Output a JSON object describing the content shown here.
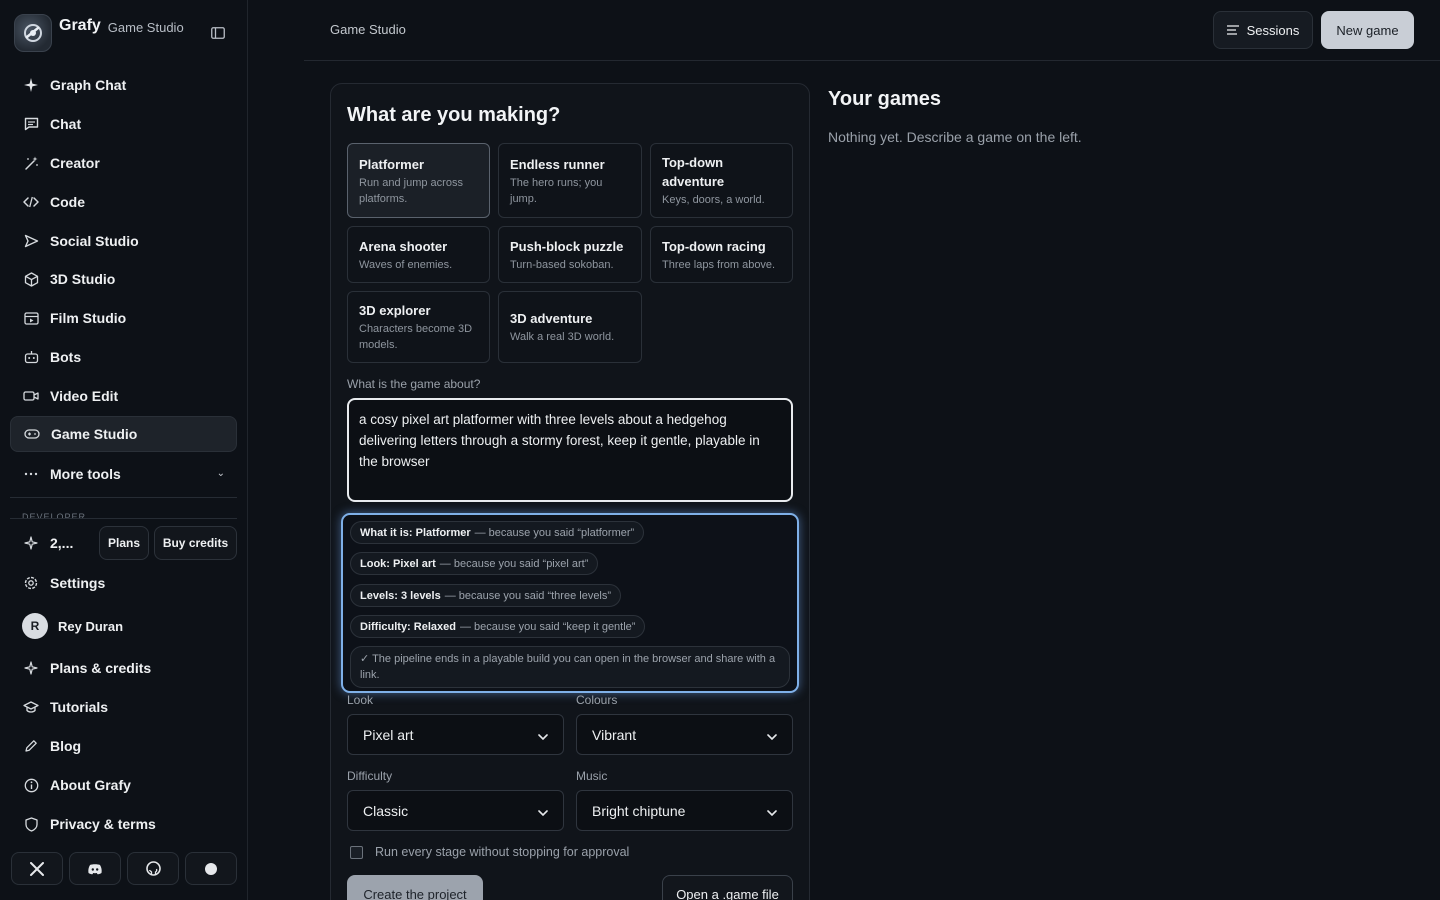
{
  "brand": {
    "name": "Grafy",
    "subtitle": "Game Studio"
  },
  "sidebar": {
    "items": [
      {
        "label": "Graph Chat",
        "icon": "sparkle-icon"
      },
      {
        "label": "Chat",
        "icon": "message-icon"
      },
      {
        "label": "Creator",
        "icon": "magic-wand-icon"
      },
      {
        "label": "Code",
        "icon": "code-icon"
      },
      {
        "label": "Social Studio",
        "icon": "send-icon"
      },
      {
        "label": "3D Studio",
        "icon": "cube-icon"
      },
      {
        "label": "Film Studio",
        "icon": "film-icon"
      },
      {
        "label": "Bots",
        "icon": "bot-icon"
      },
      {
        "label": "Video Edit",
        "icon": "video-icon"
      },
      {
        "label": "Game Studio",
        "icon": "gamepad-icon",
        "active": true
      },
      {
        "label": "More tools",
        "icon": "ellipsis-icon"
      }
    ],
    "section_label": "DEVELOPER",
    "credits": {
      "count": "2,...",
      "plans_label": "Plans",
      "buy_label": "Buy credits"
    },
    "settings_label": "Settings",
    "user": {
      "initial": "R",
      "name": "Rey Duran"
    },
    "bottom_items": [
      {
        "label": "Plans & credits",
        "icon": "sparkle-icon"
      },
      {
        "label": "Tutorials",
        "icon": "graduation-cap-icon"
      },
      {
        "label": "Blog",
        "icon": "pen-icon"
      },
      {
        "label": "About Grafy",
        "icon": "info-icon"
      },
      {
        "label": "Privacy & terms",
        "icon": "shield-icon"
      }
    ]
  },
  "topbar": {
    "title": "Game Studio",
    "sessions_label": "Sessions",
    "new_game_label": "New game"
  },
  "form": {
    "title": "What are you making?",
    "genres": [
      {
        "name": "Platformer",
        "desc": "Run and jump across platforms.",
        "selected": true
      },
      {
        "name": "Endless runner",
        "desc": "The hero runs; you jump."
      },
      {
        "name": "Top-down adventure",
        "desc": "Keys, doors, a world."
      },
      {
        "name": "Arena shooter",
        "desc": "Waves of enemies."
      },
      {
        "name": "Push-block puzzle",
        "desc": "Turn-based sokoban."
      },
      {
        "name": "Top-down racing",
        "desc": "Three laps from above."
      },
      {
        "name": "3D explorer",
        "desc": "Characters become 3D models."
      },
      {
        "name": "3D adventure",
        "desc": "Walk a real 3D world."
      }
    ],
    "about_label": "What is the game about?",
    "about_value": "a cosy pixel art platformer with three levels about a hedgehog delivering letters through a stormy forest, keep it gentle, playable in the browser",
    "reasons": [
      {
        "key": "What it is: Platformer",
        "why": "— because you said “platformer”"
      },
      {
        "key": "Look: Pixel art",
        "why": "— because you said “pixel art”"
      },
      {
        "key": "Levels: 3 levels",
        "why": "— because you said “three levels”"
      },
      {
        "key": "Difficulty: Relaxed",
        "why": "— because you said “keep it gentle”"
      }
    ],
    "pipeline_note": "✓ The pipeline ends in a playable build you can open in the browser and share with a link.",
    "look": {
      "label": "Look",
      "value": "Pixel art"
    },
    "colours": {
      "label": "Colours",
      "value": "Vibrant"
    },
    "difficulty": {
      "label": "Difficulty",
      "value": "Classic"
    },
    "music": {
      "label": "Music",
      "value": "Bright chiptune"
    },
    "auto_run_label": "Run every stage without stopping for approval",
    "create_label": "Create the project",
    "open_label": "Open a .game file"
  },
  "games": {
    "title": "Your games",
    "empty": "Nothing yet. Describe a game on the left."
  }
}
